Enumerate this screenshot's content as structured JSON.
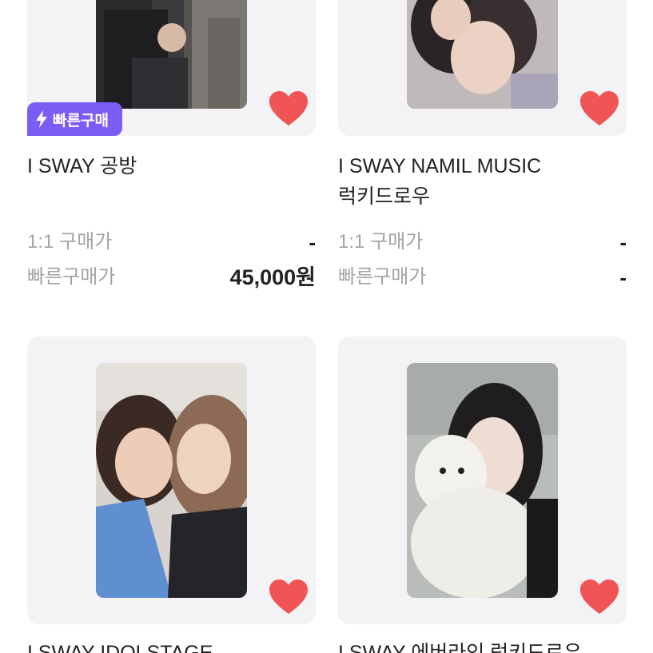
{
  "products": [
    {
      "title_lines": [
        "I SWAY 공방",
        ""
      ],
      "badge": {
        "label": "빠른구매",
        "icon": "lightning-icon"
      },
      "prices": [
        {
          "label": "1:1 구매가",
          "value": "-"
        },
        {
          "label": "빠른구매가",
          "value": "45,000원"
        }
      ]
    },
    {
      "title_lines": [
        "I SWAY NAMIL MUSIC",
        "럭키드로우"
      ],
      "prices": [
        {
          "label": "1:1 구매가",
          "value": "-"
        },
        {
          "label": "빠른구매가",
          "value": "-"
        }
      ]
    },
    {
      "title_lines": [
        "I SWAY IDOLSTAGE"
      ]
    },
    {
      "title_lines": [
        "I SWAY 에버라인 럭키드로우"
      ]
    }
  ],
  "colors": {
    "badge": "#7b5cf5",
    "heart": "#f05454",
    "thumb_bg": "#f3f3f5"
  },
  "icons": {
    "like": "heart-icon",
    "badge": "lightning-icon"
  }
}
